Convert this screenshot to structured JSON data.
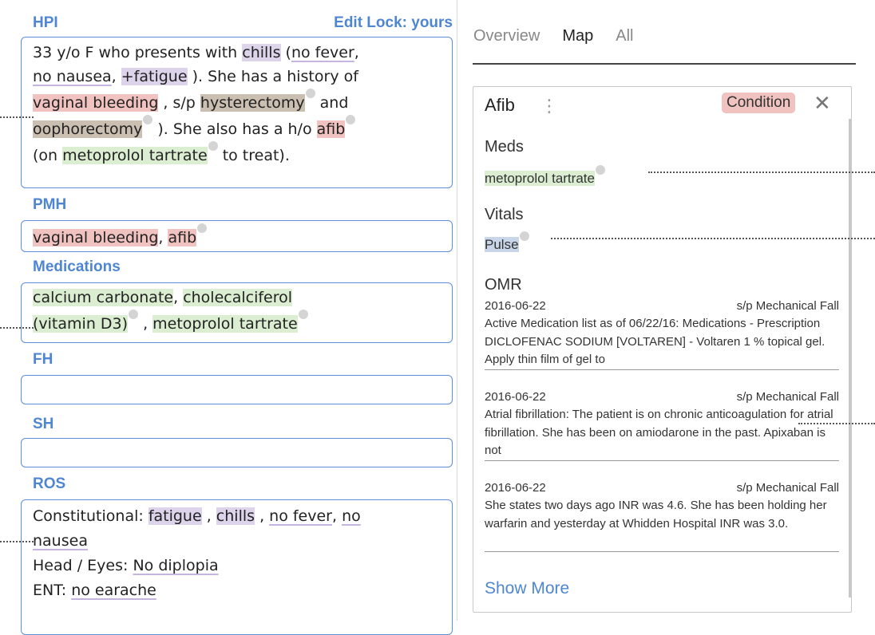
{
  "hpi": {
    "title": "HPI",
    "lock": "Edit Lock: yours",
    "t1": "33 y/o F who presents with ",
    "chills": "chills",
    "t2": " (",
    "no_fever": "no fever",
    "t3": ",",
    "no_nausea": "no nausea",
    "t4": ", ",
    "fatigue": "+fatigue",
    "t5": " ). She has a history of",
    "vag": "vaginal bleeding",
    "t6": " , s/p ",
    "hyst": "hysterectomy",
    "t7": " and",
    "ooph": "oophorectomy",
    "t8": " ). She also has a h/o ",
    "afib": "afib",
    "t9": "(on ",
    "meto": "metoprolol tartrate",
    "t10": " to treat)."
  },
  "pmh": {
    "title": "PMH",
    "vag": "vaginal bleeding",
    "sep": ", ",
    "afib": "afib"
  },
  "medications": {
    "title": "Medications",
    "m1": "calcium carbonate",
    "sep1": ", ",
    "m2": "cholecalciferol",
    "m2b": "(vitamin D3)",
    "sep2": " , ",
    "m3": "metoprolol tartrate"
  },
  "fh": {
    "title": "FH"
  },
  "sh": {
    "title": "SH"
  },
  "ros": {
    "title": "ROS",
    "l1a": "Constitutional: ",
    "fatigue": "fatigue",
    "s1": " , ",
    "chills": "chills",
    "s2": " , ",
    "no_fever": "no fever",
    "s3": ", ",
    "no": "no",
    "nausea": "nausea",
    "l3a": "Head / Eyes: ",
    "no_diplopia": "No diplopia",
    "l4a": "ENT: ",
    "no_earache": "no earache"
  },
  "tabs": [
    "Overview",
    "Map",
    "All"
  ],
  "card": {
    "title": "Afib",
    "badge": "Condition",
    "meds_label": "Meds",
    "meds_value": "metoprolol tartrate",
    "vitals_label": "Vitals",
    "vitals_value": "Pulse",
    "omr_label": "OMR",
    "omr": [
      {
        "date": "2016-06-22",
        "tag": "s/p Mechanical Fall",
        "text": "Active Medication list as of 06/22/16: Medications - Prescription DICLOFENAC SODIUM [VOLTAREN] - Voltaren 1 % topical gel. Apply thin film of gel to"
      },
      {
        "date": "2016-06-22",
        "tag": "s/p Mechanical Fall",
        "text": "Atrial fibrillation: The patient is on chronic anticoagulation for atrial fibrillation. She has been on amiodarone in the past. Apixaban is not"
      },
      {
        "date": "2016-06-22",
        "tag": "s/p Mechanical Fall",
        "text": "She states two days ago INR was 4.6. She has been holding her warfarin and yesterday at Whidden Hospital INR was 3.0."
      }
    ],
    "show_more": "Show More"
  },
  "colors": {
    "accent": "#4f86d1",
    "condition": "#f0c2c0",
    "medication": "#dceed2",
    "symptom": "#ddd3ea",
    "procedure": "#cbbfb1",
    "vital": "#c9d6ea"
  }
}
